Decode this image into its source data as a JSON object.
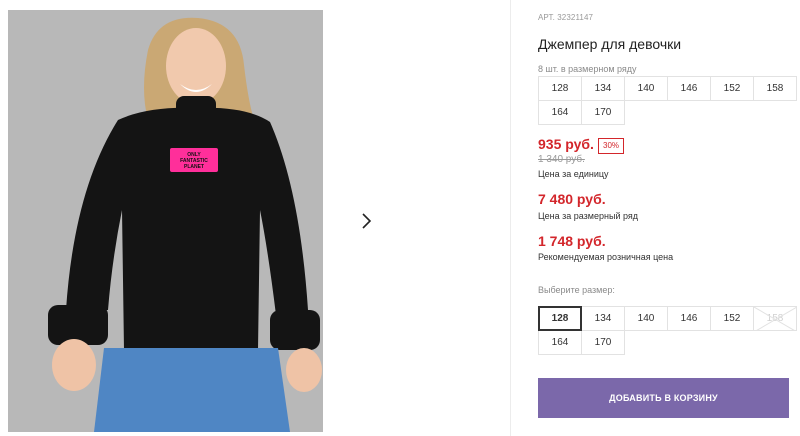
{
  "product": {
    "article": "АРТ. 32321147",
    "title": "Джемпер для девочки",
    "pack_note": "8 шт. в размерном ряду",
    "pack_sizes": [
      "128",
      "134",
      "140",
      "146",
      "152",
      "158",
      "164",
      "170"
    ]
  },
  "photo": {
    "patch_lines": [
      "ONLY",
      "FANTASTIC",
      "PLANET"
    ]
  },
  "pricing": {
    "unit_price": "935 руб.",
    "discount": "30%",
    "old_price": "1 340 руб.",
    "unit_label": "Цена за единицу",
    "pack_price": "7 480 руб.",
    "pack_label": "Цена за размерный ряд",
    "retail_price": "1 748 руб.",
    "retail_label": "Рекомендуемая розничная цена"
  },
  "size_picker": {
    "label": "Выберите размер:",
    "selected": "128",
    "disabled": "158",
    "sizes": [
      "128",
      "134",
      "140",
      "146",
      "152",
      "158",
      "164",
      "170"
    ]
  },
  "actions": {
    "add_to_cart": "ДОБАВИТЬ В КОРЗИНУ"
  },
  "colors": {
    "price_red": "#d3262b",
    "button_purple": "#7b68aa",
    "sweater_black": "#141414",
    "jeans_blue": "#4f86c4",
    "patch_pink": "#ff2f9a"
  }
}
